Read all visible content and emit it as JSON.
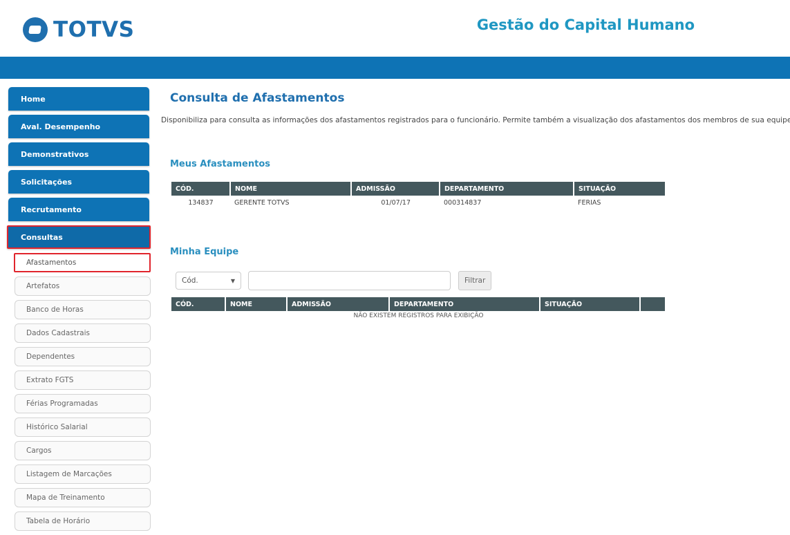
{
  "brand": {
    "logo_text": "TOTVS",
    "app_title": "Gestão do Capital Humano",
    "color": "#1f6fae"
  },
  "menu": {
    "main_items": [
      {
        "label": "Home"
      },
      {
        "label": "Aval. Desempenho"
      },
      {
        "label": "Demonstrativos"
      },
      {
        "label": "Solicitações"
      },
      {
        "label": "Recrutamento"
      },
      {
        "label": "Consultas"
      }
    ],
    "sub_items": [
      {
        "label": "Afastamentos"
      },
      {
        "label": "Artefatos"
      },
      {
        "label": "Banco de Horas"
      },
      {
        "label": "Dados Cadastrais"
      },
      {
        "label": "Dependentes"
      },
      {
        "label": "Extrato FGTS"
      },
      {
        "label": "Férias Programadas"
      },
      {
        "label": "Histórico Salarial"
      },
      {
        "label": "Cargos"
      },
      {
        "label": "Listagem de Marcações"
      },
      {
        "label": "Mapa de Treinamento"
      },
      {
        "label": "Tabela de Horário"
      }
    ]
  },
  "page": {
    "title": "Consulta de Afastamentos",
    "description": "Disponibiliza para consulta as informações dos afastamentos registrados para o funcionário. Permite também a visualização dos afastamentos dos membros de sua equipe."
  },
  "meus": {
    "title": "Meus Afastamentos",
    "headers": [
      "CÓD.",
      "NOME",
      "ADMISSÃO",
      "DEPARTAMENTO",
      "SITUAÇÃO"
    ],
    "row": {
      "cod": "134837",
      "nome": "GERENTE TOTVS",
      "admissao": "01/07/17",
      "departamento": "000314837",
      "situacao": "FERIAS"
    }
  },
  "equipe": {
    "title": "Minha Equipe",
    "select_value": "Cód.",
    "filter_label": "Filtrar",
    "headers": [
      "CÓD.",
      "NOME",
      "ADMISSÃO",
      "DEPARTAMENTO",
      "SITUAÇÃO"
    ],
    "empty_message": "NÃO EXISTEM REGISTROS PARA EXIBIÇÃO"
  },
  "colors": {
    "topbar": "#0e73b5",
    "highlight": "#e0242c",
    "table_header": "#44585d"
  }
}
